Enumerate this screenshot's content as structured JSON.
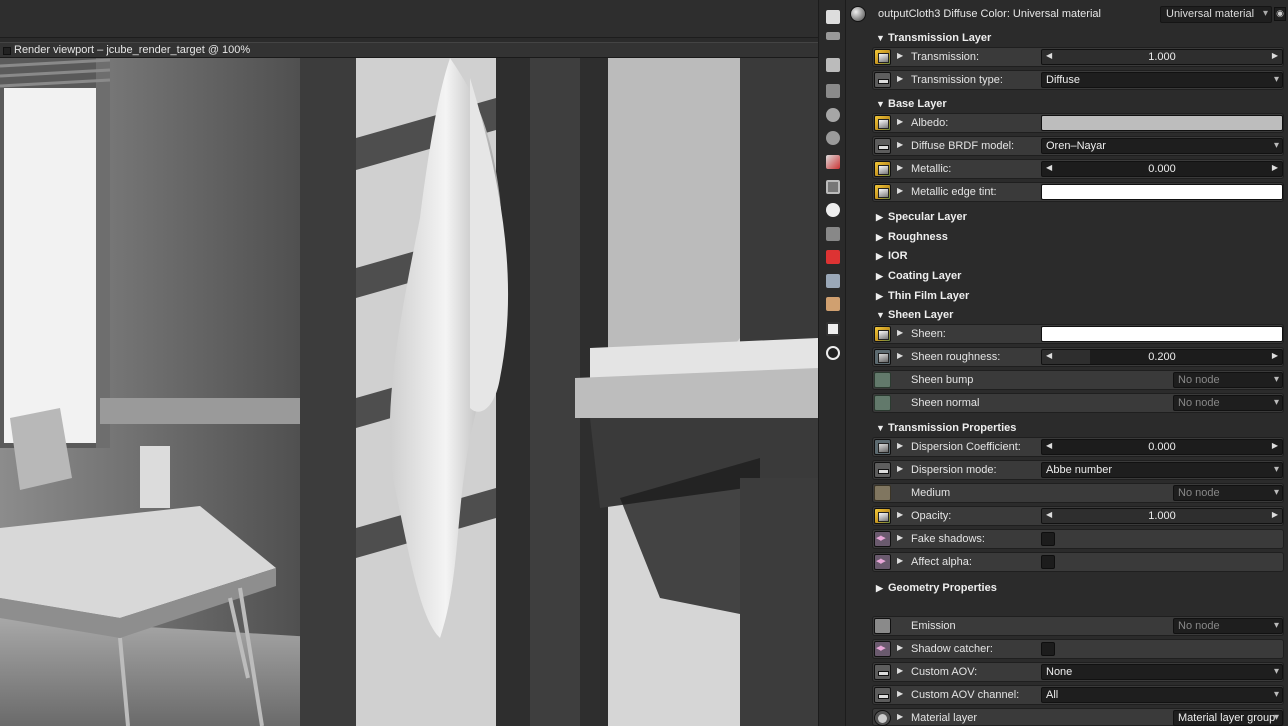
{
  "viewport": {
    "title": "Render viewport – jcube_render_target @ 100%"
  },
  "panel": {
    "title": "outputCloth3 Diffuse Color: Universal material",
    "material_type": "Universal material",
    "sections": {
      "transmission_layer": "Transmission Layer",
      "base_layer": "Base Layer",
      "specular_layer": "Specular Layer",
      "roughness": "Roughness",
      "ior": "IOR",
      "coating_layer": "Coating Layer",
      "thin_film_layer": "Thin Film Layer",
      "sheen_layer": "Sheen Layer",
      "transmission_properties": "Transmission Properties",
      "geometry_properties": "Geometry Properties"
    },
    "rows": {
      "transmission": {
        "label": "Transmission:",
        "value": "1.000",
        "fraction": 1.0
      },
      "transmission_type": {
        "label": "Transmission type:",
        "value": "Diffuse"
      },
      "albedo": {
        "label": "Albedo:",
        "color": "#bdbdbd"
      },
      "diffuse_brdf": {
        "label": "Diffuse BRDF model:",
        "value": "Oren–Nayar"
      },
      "metallic": {
        "label": "Metallic:",
        "value": "0.000",
        "fraction": 0.0
      },
      "metallic_edge_tint": {
        "label": "Metallic edge tint:",
        "color": "#ffffff"
      },
      "sheen": {
        "label": "Sheen:",
        "color": "#ffffff"
      },
      "sheen_roughness": {
        "label": "Sheen roughness:",
        "value": "0.200",
        "fraction": 0.2
      },
      "sheen_bump": {
        "label": "Sheen bump",
        "value": "No node"
      },
      "sheen_normal": {
        "label": "Sheen normal",
        "value": "No node"
      },
      "dispersion_coefficient": {
        "label": "Dispersion Coefficient:",
        "value": "0.000",
        "fraction": 0.0
      },
      "dispersion_mode": {
        "label": "Dispersion mode:",
        "value": "Abbe number"
      },
      "medium": {
        "label": "Medium",
        "value": "No node"
      },
      "opacity": {
        "label": "Opacity:",
        "value": "1.000",
        "fraction": 1.0
      },
      "fake_shadows": {
        "label": "Fake shadows:",
        "checked": false
      },
      "affect_alpha": {
        "label": "Affect alpha:",
        "checked": false
      },
      "emission": {
        "label": "Emission",
        "value": "No node"
      },
      "shadow_catcher": {
        "label": "Shadow catcher:",
        "checked": false
      },
      "custom_aov": {
        "label": "Custom AOV:",
        "value": "None"
      },
      "custom_aov_channel": {
        "label": "Custom AOV channel:",
        "value": "All"
      },
      "material_layer": {
        "label": "Material layer",
        "value": "Material layer group"
      }
    }
  },
  "toolbar_icons": [
    "node-graph-icon",
    "outliner-icon",
    "image-icon",
    "camera-icon",
    "geometry-icon",
    "material-icon",
    "paint-icon",
    "texture-icon",
    "time-icon",
    "settings-icon",
    "red-cube-icon",
    "blue-cube-icon",
    "orange-cube-icon",
    "environment-icon",
    "light-icon"
  ]
}
